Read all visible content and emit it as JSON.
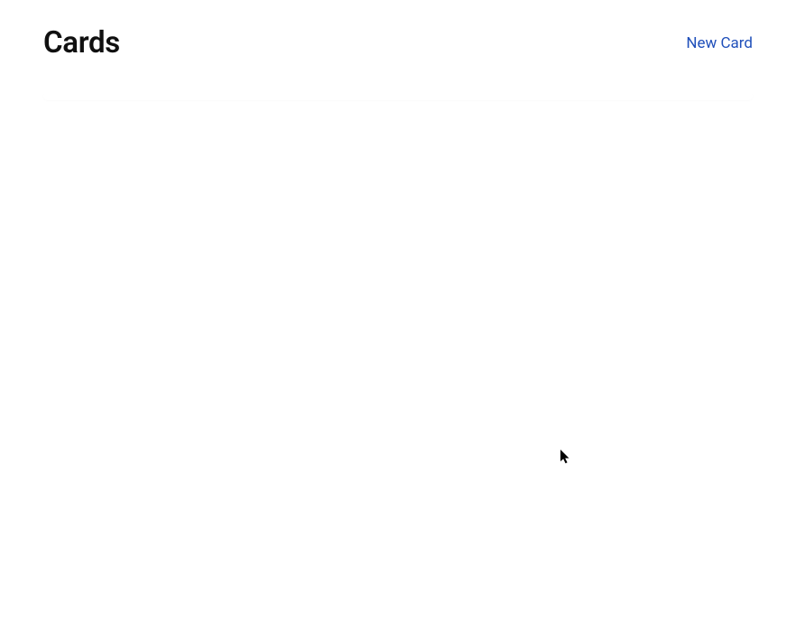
{
  "header": {
    "title": "Cards",
    "new_card_label": "New Card"
  }
}
